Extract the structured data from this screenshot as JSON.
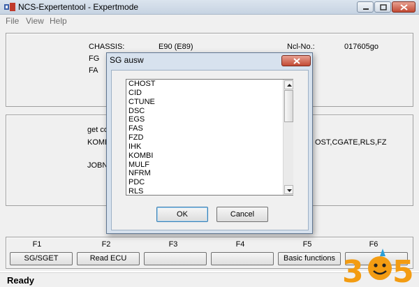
{
  "window": {
    "title": "NCS-Expertentool - Expertmode"
  },
  "menu": {
    "items": [
      "File",
      "View",
      "Help"
    ]
  },
  "vehicle_panel": {
    "chassis_label": "CHASSIS:",
    "chassis_value": "E90 (E89)",
    "fg_label": "FG",
    "fa_label": "FA",
    "ncl_label": "Ncl-No.:",
    "ncl_value": "017605go"
  },
  "job_panel": {
    "get_label": "get co",
    "kombi_label": "KOMB",
    "ecu_list_fragment": "OST,CGATE,RLS,FZ",
    "jobname_label": "JOBNA"
  },
  "function_keys": [
    {
      "key": "F1",
      "label": "SG/SGET"
    },
    {
      "key": "F2",
      "label": "Read ECU"
    },
    {
      "key": "F3",
      "label": ""
    },
    {
      "key": "F4",
      "label": ""
    },
    {
      "key": "F5",
      "label": "Basic functions"
    },
    {
      "key": "F6",
      "label": ""
    }
  ],
  "status": {
    "text": "Ready"
  },
  "dialog": {
    "title": "SG ausw",
    "close_glyph": "x",
    "items": [
      "CHOST",
      "CID",
      "CTUNE",
      "DSC",
      "EGS",
      "FAS",
      "FZD",
      "IHK",
      "KOMBI",
      "MULF",
      "NFRM",
      "PDC",
      "RLS"
    ],
    "ok_label": "OK",
    "cancel_label": "Cancel"
  },
  "colors": {
    "titlebar": "#c6d3e2",
    "close_button": "#c24a34",
    "dialog_frame": "#d7e2ee",
    "logo_orange": "#f39c12",
    "logo_blue": "#2b9fd9"
  },
  "watermark": {
    "text": "305"
  }
}
